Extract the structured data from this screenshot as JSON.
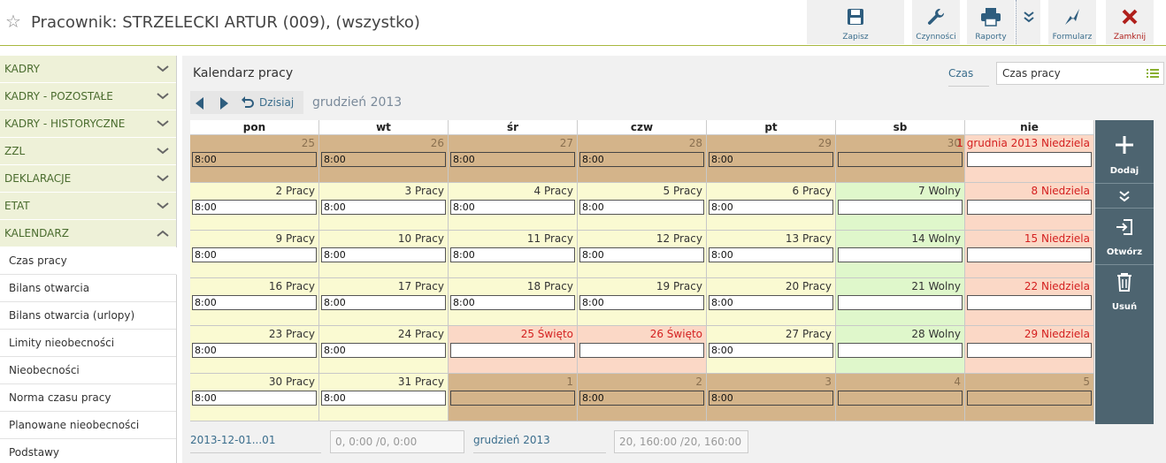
{
  "header": {
    "title": "Pracownik: STRZELECKI ARTUR (009), (wszystko)",
    "toolbar": {
      "save": "Zapisz",
      "actions": "Czynności",
      "reports": "Raporty",
      "form": "Formularz",
      "close": "Zamknij"
    }
  },
  "sidebar": {
    "sections": [
      "KADRY",
      "KADRY - POZOSTAŁE",
      "KADRY - HISTORYCZNE",
      "ZZL",
      "DEKLARACJE",
      "ETAT",
      "KALENDARZ"
    ],
    "items": [
      "Czas pracy",
      "Bilans otwarcia",
      "Bilans otwarcia (urlopy)",
      "Limity nieobecności",
      "Nieobecności",
      "Norma czasu pracy",
      "Planowane nieobecności",
      "Podstawy"
    ]
  },
  "main": {
    "title": "Kalendarz pracy",
    "czas_label": "Czas",
    "czas_value": "Czas pracy",
    "today": "Dzisiaj",
    "month": "grudzień 2013"
  },
  "calendar": {
    "days": [
      "pon",
      "wt",
      "śr",
      "czw",
      "pt",
      "sb",
      "nie"
    ],
    "weeks": [
      [
        {
          "label": "25",
          "time": "8:00",
          "type": "oth"
        },
        {
          "label": "26",
          "time": "8:00",
          "type": "oth"
        },
        {
          "label": "27",
          "time": "8:00",
          "type": "oth"
        },
        {
          "label": "28",
          "time": "8:00",
          "type": "oth"
        },
        {
          "label": "29",
          "time": "8:00",
          "type": "oth"
        },
        {
          "label": "30",
          "time": "",
          "type": "oth"
        },
        {
          "label": "1 grudnia 2013 Niedziela",
          "time": "",
          "type": "sun"
        }
      ],
      [
        {
          "label": "2 Pracy",
          "time": "8:00",
          "type": "w"
        },
        {
          "label": "3 Pracy",
          "time": "8:00",
          "type": "w"
        },
        {
          "label": "4 Pracy",
          "time": "8:00",
          "type": "w"
        },
        {
          "label": "5 Pracy",
          "time": "8:00",
          "type": "w"
        },
        {
          "label": "6 Pracy",
          "time": "8:00",
          "type": "w"
        },
        {
          "label": "7 Wolny",
          "time": "",
          "type": "sat"
        },
        {
          "label": "8 Niedziela",
          "time": "",
          "type": "sun"
        }
      ],
      [
        {
          "label": "9 Pracy",
          "time": "8:00",
          "type": "w"
        },
        {
          "label": "10 Pracy",
          "time": "8:00",
          "type": "w"
        },
        {
          "label": "11 Pracy",
          "time": "8:00",
          "type": "w"
        },
        {
          "label": "12 Pracy",
          "time": "8:00",
          "type": "w"
        },
        {
          "label": "13 Pracy",
          "time": "8:00",
          "type": "w"
        },
        {
          "label": "14 Wolny",
          "time": "",
          "type": "sat"
        },
        {
          "label": "15 Niedziela",
          "time": "",
          "type": "sun"
        }
      ],
      [
        {
          "label": "16 Pracy",
          "time": "8:00",
          "type": "w"
        },
        {
          "label": "17 Pracy",
          "time": "8:00",
          "type": "w"
        },
        {
          "label": "18 Pracy",
          "time": "8:00",
          "type": "w"
        },
        {
          "label": "19 Pracy",
          "time": "8:00",
          "type": "w"
        },
        {
          "label": "20 Pracy",
          "time": "8:00",
          "type": "w"
        },
        {
          "label": "21 Wolny",
          "time": "",
          "type": "sat"
        },
        {
          "label": "22 Niedziela",
          "time": "",
          "type": "sun"
        }
      ],
      [
        {
          "label": "23 Pracy",
          "time": "8:00",
          "type": "w"
        },
        {
          "label": "24 Pracy",
          "time": "8:00",
          "type": "w"
        },
        {
          "label": "25 Święto",
          "time": "",
          "type": "hol"
        },
        {
          "label": "26 Święto",
          "time": "",
          "type": "hol"
        },
        {
          "label": "27 Pracy",
          "time": "8:00",
          "type": "w"
        },
        {
          "label": "28 Wolny",
          "time": "",
          "type": "sat"
        },
        {
          "label": "29 Niedziela",
          "time": "",
          "type": "sun"
        }
      ],
      [
        {
          "label": "30 Pracy",
          "time": "8:00",
          "type": "w"
        },
        {
          "label": "31 Pracy",
          "time": "8:00",
          "type": "w"
        },
        {
          "label": "1",
          "time": "",
          "type": "oth"
        },
        {
          "label": "2",
          "time": "8:00",
          "type": "oth"
        },
        {
          "label": "3",
          "time": "8:00",
          "type": "oth"
        },
        {
          "label": "4",
          "time": "",
          "type": "oth"
        },
        {
          "label": "5",
          "time": "",
          "type": "oth"
        }
      ]
    ]
  },
  "actions": {
    "add": "Dodaj",
    "open": "Otwórz",
    "delete": "Usuń"
  },
  "footer": {
    "range": "2013-12-01...01",
    "range_value": "0, 0:00 /0, 0:00",
    "month": "grudzień 2013",
    "month_value": "20, 160:00 /20, 160:00"
  }
}
